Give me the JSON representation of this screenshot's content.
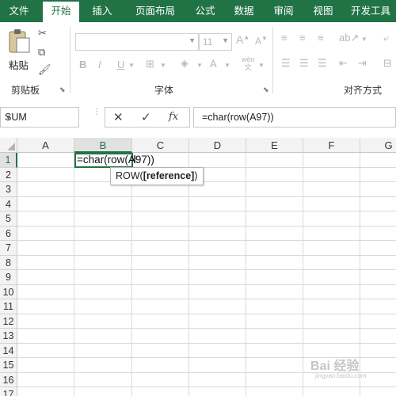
{
  "tabs": [
    "文件",
    "开始",
    "插入",
    "页面布局",
    "公式",
    "数据",
    "审阅",
    "视图",
    "开发工具"
  ],
  "active_tab": "开始",
  "ribbon": {
    "clipboard": {
      "paste_label": "粘贴",
      "group_label": "剪贴板"
    },
    "font": {
      "font_name": "",
      "font_size": "11",
      "group_label": "字体",
      "wen_label": "wén"
    },
    "alignment": {
      "group_label": "对齐方式"
    }
  },
  "formula_bar": {
    "name_box": "SUM",
    "cancel_icon": "close-icon",
    "enter_icon": "check-icon",
    "fx_label": "fx",
    "formula": "=char(row(A97))"
  },
  "columns": [
    "A",
    "B",
    "C",
    "D",
    "E",
    "F",
    "G"
  ],
  "rows": [
    "1",
    "2",
    "3",
    "4",
    "5",
    "6",
    "7",
    "8",
    "9",
    "10",
    "11",
    "12",
    "13",
    "14",
    "15",
    "16",
    "17"
  ],
  "active_cell": {
    "ref": "B1",
    "editing_text": "=char(row(A97))"
  },
  "tooltip": {
    "func": "ROW(",
    "arg": "[reference]",
    "close": ")"
  },
  "watermark": {
    "main": "Bai 经验",
    "sub": "jingyan.baidu.com"
  },
  "colors": {
    "accent": "#217346"
  }
}
